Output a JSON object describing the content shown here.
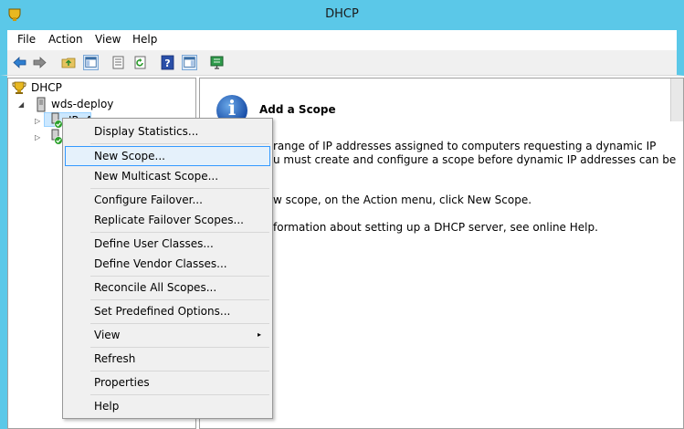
{
  "window": {
    "title": "DHCP",
    "accent": "#5bc8e8"
  },
  "menubar": {
    "file": "File",
    "action": "Action",
    "view": "View",
    "help": "Help"
  },
  "toolbar": {
    "icons": [
      "back-arrow-icon",
      "forward-arrow-icon",
      "up-folder-icon",
      "show-hide-console-tree-icon",
      "properties-icon",
      "refresh-icon",
      "help-icon",
      "show-hide-action-pane-icon",
      "monitor-icon"
    ]
  },
  "tree": {
    "root": "DHCP",
    "server": "wds-deploy",
    "ipv4": "IPv4"
  },
  "info": {
    "heading": "Add a Scope",
    "line1": "range of IP addresses assigned to computers requesting a dynamic IP",
    "line2": "u must create and configure a scope before dynamic IP addresses can be",
    "line3": "w scope, on the Action menu, click New Scope.",
    "line4": "formation about setting up a DHCP server, see online Help."
  },
  "context_menu": {
    "items": [
      "Display Statistics...",
      "New Scope...",
      "New Multicast Scope...",
      "Configure Failover...",
      "Replicate Failover Scopes...",
      "Define User Classes...",
      "Define Vendor Classes...",
      "Reconcile All Scopes...",
      "Set Predefined Options...",
      "View",
      "Refresh",
      "Properties",
      "Help"
    ],
    "highlighted": "New Scope...",
    "submenu_arrow": "▸"
  }
}
